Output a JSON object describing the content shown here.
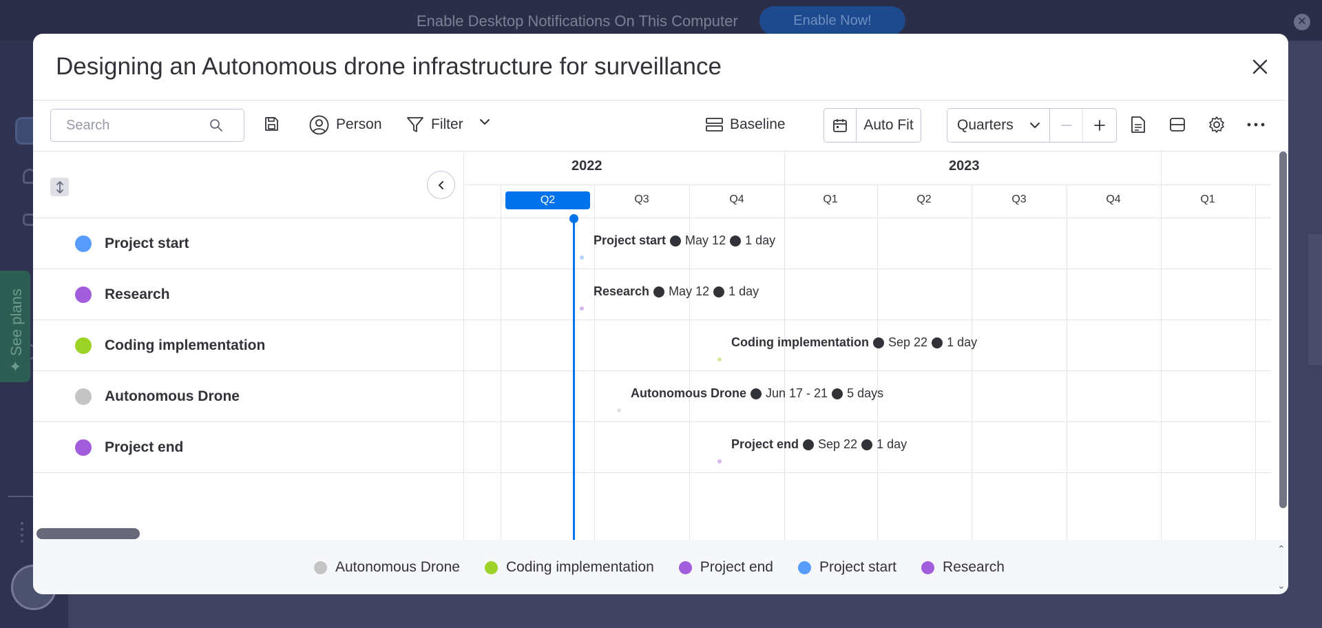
{
  "notification": {
    "text": "Enable Desktop Notifications On This Computer",
    "button_label": "Enable Now!"
  },
  "background": {
    "see_plans_label": "See plans"
  },
  "modal": {
    "title": "Designing an Autonomous drone infrastructure for surveillance"
  },
  "toolbar": {
    "search_placeholder": "Search",
    "person_label": "Person",
    "filter_label": "Filter",
    "baseline_label": "Baseline",
    "autofit_label": "Auto Fit",
    "zoom_select_value": "Quarters"
  },
  "timeline": {
    "years": [
      "2022",
      "2023"
    ],
    "quarters": [
      "Q2",
      "Q3",
      "Q4",
      "Q1",
      "Q2",
      "Q3",
      "Q4",
      "Q1"
    ],
    "current_quarter": "Q2"
  },
  "items": [
    {
      "name": "Project start",
      "color": "#579bfc",
      "date": "May 12",
      "duration": "1 day"
    },
    {
      "name": "Research",
      "color": "#a25ddc",
      "date": "May 12",
      "duration": "1 day"
    },
    {
      "name": "Coding implementation",
      "color": "#9cd326",
      "date": "Sep 22",
      "duration": "1 day"
    },
    {
      "name": "Autonomous Drone",
      "color": "#c4c4c4",
      "date": "Jun 17 - 21",
      "duration": "5 days"
    },
    {
      "name": "Project end",
      "color": "#a25ddc",
      "date": "Sep 22",
      "duration": "1 day"
    }
  ],
  "legend": [
    {
      "label": "Autonomous Drone",
      "color": "#c4c4c4"
    },
    {
      "label": "Coding implementation",
      "color": "#9cd326"
    },
    {
      "label": "Project end",
      "color": "#a25ddc"
    },
    {
      "label": "Project start",
      "color": "#579bfc"
    },
    {
      "label": "Research",
      "color": "#a25ddc"
    }
  ],
  "icons": [
    "search-icon",
    "save-icon",
    "person-icon",
    "filter-icon",
    "chevron-down-icon",
    "baseline-icon",
    "calendar-icon",
    "minus-icon",
    "plus-icon",
    "export-icon",
    "split-view-icon",
    "gear-icon",
    "more-icon",
    "close-icon",
    "collapse-chevron-icon",
    "sort-icon"
  ]
}
